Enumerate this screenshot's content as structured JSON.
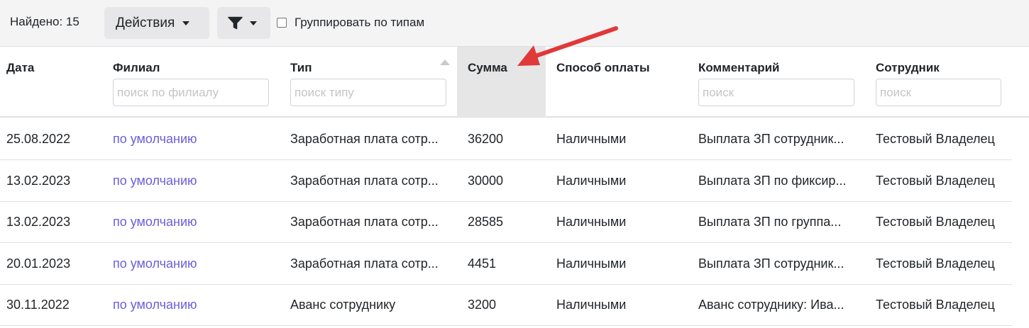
{
  "toolbar": {
    "found_label": "Найдено: 15",
    "actions_label": "Действия",
    "group_label": "Группировать по типам",
    "group_checked": false
  },
  "columns": [
    {
      "label": "Дата",
      "placeholder": ""
    },
    {
      "label": "Филиал",
      "placeholder": "поиск по филиалу"
    },
    {
      "label": "Тип",
      "placeholder": "поиск типу"
    },
    {
      "label": "Сумма",
      "placeholder": ""
    },
    {
      "label": "Способ оплаты",
      "placeholder": ""
    },
    {
      "label": "Комментарий",
      "placeholder": "поиск"
    },
    {
      "label": "Сотрудник",
      "placeholder": "поиск"
    }
  ],
  "sorted_column": "Сумма",
  "rows": [
    {
      "date": "25.08.2022",
      "branch": "по умолчанию",
      "type": "Заработная плата сотр...",
      "amount": "36200",
      "payment": "Наличными",
      "comment": "Выплата ЗП сотрудник...",
      "employee": "Тестовый Владелец"
    },
    {
      "date": "13.02.2023",
      "branch": "по умолчанию",
      "type": "Заработная плата сотр...",
      "amount": "30000",
      "payment": "Наличными",
      "comment": "Выплата ЗП по фиксир...",
      "employee": "Тестовый Владелец"
    },
    {
      "date": "13.02.2023",
      "branch": "по умолчанию",
      "type": "Заработная плата сотр...",
      "amount": "28585",
      "payment": "Наличными",
      "comment": "Выплата ЗП по группа...",
      "employee": "Тестовый Владелец"
    },
    {
      "date": "20.01.2023",
      "branch": "по умолчанию",
      "type": "Заработная плата сотр...",
      "amount": "4451",
      "payment": "Наличными",
      "comment": "Выплата ЗП сотрудник...",
      "employee": "Тестовый Владелец"
    },
    {
      "date": "30.11.2022",
      "branch": "по умолчанию",
      "type": "Аванс сотруднику",
      "amount": "3200",
      "payment": "Наличными",
      "comment": "Аванс сотруднику: Ива...",
      "employee": "Тестовый Владелец"
    }
  ],
  "icons": {
    "filter": "funnel-icon",
    "dropdown": "caret-down-icon",
    "sort": "sort-up-icon",
    "annotation": "red-arrow-icon"
  },
  "colors": {
    "link": "#6a5fd8",
    "sorted_header_bg": "#e6e6e6",
    "annotation_arrow": "#e0393a"
  }
}
